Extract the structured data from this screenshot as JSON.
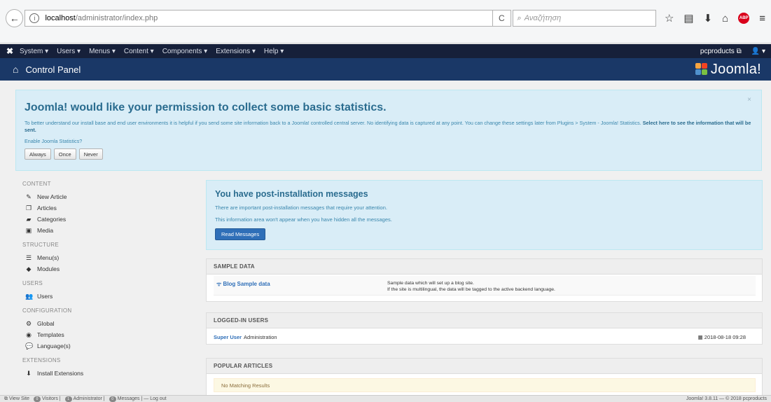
{
  "browser": {
    "url_host": "localhost",
    "url_path": "/administrator/index.php",
    "search_placeholder": "Αναζήτηση"
  },
  "admin_nav": {
    "menus": [
      "System ▾",
      "Users ▾",
      "Menus ▾",
      "Content ▾",
      "Components ▾",
      "Extensions ▾",
      "Help ▾"
    ],
    "site_name": "pcproducts",
    "user_menu": "▾"
  },
  "header": {
    "title": "Control Panel",
    "brand": "Joomla!"
  },
  "stats_banner": {
    "heading": "Joomla! would like your permission to collect some basic statistics.",
    "description": "To better understand our install base and end user environments it is helpful if you send some site information back to a Joomla! controlled central server. No identifying data is captured at any point. You can change these settings later from Plugins > System - Joomla! Statistics.",
    "select_link": "Select here to see the information that will be sent.",
    "enable_label": "Enable Joomla Statistics?",
    "buttons": [
      "Always",
      "Once",
      "Never"
    ],
    "close": "×"
  },
  "sidebar": {
    "groups": [
      {
        "heading": "CONTENT",
        "items": [
          {
            "label": "New Article",
            "icon": "pencil-icon"
          },
          {
            "label": "Articles",
            "icon": "stack-icon"
          },
          {
            "label": "Categories",
            "icon": "folder-icon"
          },
          {
            "label": "Media",
            "icon": "image-icon"
          }
        ]
      },
      {
        "heading": "STRUCTURE",
        "items": [
          {
            "label": "Menu(s)",
            "icon": "list-icon"
          },
          {
            "label": "Modules",
            "icon": "cube-icon"
          }
        ]
      },
      {
        "heading": "USERS",
        "items": [
          {
            "label": "Users",
            "icon": "users-icon"
          }
        ]
      },
      {
        "heading": "CONFIGURATION",
        "items": [
          {
            "label": "Global",
            "icon": "cog-icon"
          },
          {
            "label": "Templates",
            "icon": "eye-icon"
          },
          {
            "label": "Language(s)",
            "icon": "comments-icon"
          }
        ]
      },
      {
        "heading": "EXTENSIONS",
        "items": [
          {
            "label": "Install Extensions",
            "icon": "download-icon"
          }
        ]
      }
    ]
  },
  "post_install": {
    "heading": "You have post-installation messages",
    "line1": "There are important post-installation messages that require your attention.",
    "line2": "This information area won't appear when you have hidden all the messages.",
    "button": "Read Messages"
  },
  "sample_data": {
    "heading": "SAMPLE DATA",
    "link": "Blog Sample data",
    "desc1": "Sample data which will set up a blog site.",
    "desc2": "If the site is multilingual, the data will be tagged to the active backend language."
  },
  "logged_in": {
    "heading": "LOGGED-IN USERS",
    "user": "Super User",
    "role": "Administration",
    "datetime": "2018-08-18 09:28"
  },
  "popular": {
    "heading": "POPULAR ARTICLES",
    "empty": "No Matching Results"
  },
  "statusbar": {
    "view_site": "View Site",
    "visitors_count": "0",
    "visitors": "Visitors",
    "admin_count": "1",
    "admin": "Administrator",
    "messages_count": "0",
    "messages": "Messages",
    "logout": "Log out",
    "version": "Joomla! 3.8.11 — © 2018 pcproducts"
  }
}
